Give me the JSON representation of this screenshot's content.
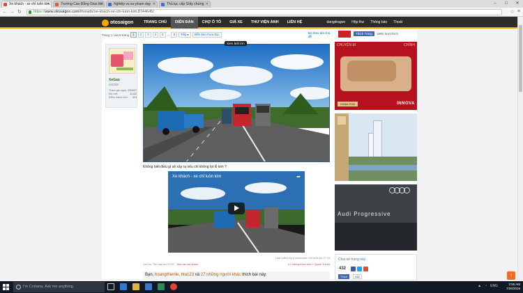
{
  "browser": {
    "tabs": [
      {
        "label": "Xe khách - xe chỉ luôn kìm",
        "active": true
      },
      {
        "label": "Trường Cao Đẳng Giao thô",
        "active": false
      },
      {
        "label": "Nghiệp vụ sư phạm dạy",
        "active": false
      },
      {
        "label": "Thủ tục cấp Giấy chứng",
        "active": false
      }
    ],
    "url_scheme": "https://",
    "url_host": "www.otosaigon.com",
    "url_path": "/threads/xe-khach-xe-chi-luon-kim.8744645/"
  },
  "site": {
    "logo_text": "otosaigon",
    "menu": [
      "TRANG CHỦ",
      "DIỄN ĐÀN",
      "CHỢ Ô TÔ",
      "GIÁ XE",
      "THƯ VIỆN ẢNH",
      "LIÊN HỆ"
    ],
    "active_menu_index": 1,
    "user_menu": [
      "dangdragon",
      "Hộp thư",
      "Thông báo",
      "Thoát"
    ]
  },
  "pager": {
    "info": "Trang 1 của 8 trang",
    "pages": [
      "1",
      "2",
      "3",
      "4",
      "5",
      "...",
      "8"
    ],
    "current": "1",
    "next_label": "Tiếp ▸",
    "goto_label": "Đến bài chưa đọc",
    "unread_label": "Bỏ theo dõi chủ đề"
  },
  "author": {
    "name": "XeGan",
    "rank": "OSOM",
    "stats": [
      {
        "label": "Tham gia ngày:",
        "value": "23/4/07"
      },
      {
        "label": "Bài viết:",
        "value": "8,432"
      },
      {
        "label": "Điểm thành tích:",
        "value": "113"
      }
    ]
  },
  "post": {
    "zoom_label": "Xem ảnh lớn",
    "caption": "Không biết điều gì sẽ xảy ra nếu chỉ không lọt lỗ kim ?",
    "video_title": "Xe khách - xe chỉ luôn kìm",
    "edited_note": "Last edited by a moderator: Chỉ nhật lúc 07:03",
    "meta_author": "XeGan, Thứ bảy lúc 22:35",
    "report_label": "Báo cáo sai phạm",
    "post_number": "#1",
    "actions": "Không thích nữa  + Quote  Trả lời",
    "likes_prefix": "Bạn,",
    "likes_users": "hoangthienle, hta123",
    "likes_mid": "và",
    "likes_others": "27 những người khác",
    "likes_suffix": "thích bài này."
  },
  "sidebar": {
    "fb_like_label": "Thích Trang",
    "fb_like_count": "196K lượt thích",
    "ad1_left": "CHUYỆN ĐI",
    "ad1_right": "CHÍNH",
    "ad1_button": "KHÁM PHÁ",
    "ad1_brand": "INNOVA",
    "ad3_brand": "Audi Progressive",
    "share_title": "Chia sẻ trang này",
    "share_count": "432",
    "fb_button": "Thích",
    "fb_count": "432"
  },
  "taskbar": {
    "search_placeholder": "I'm Cortana. Ask me anything.",
    "lang": "ENG",
    "time": "2:55 AM",
    "date": "7/26/2016"
  }
}
